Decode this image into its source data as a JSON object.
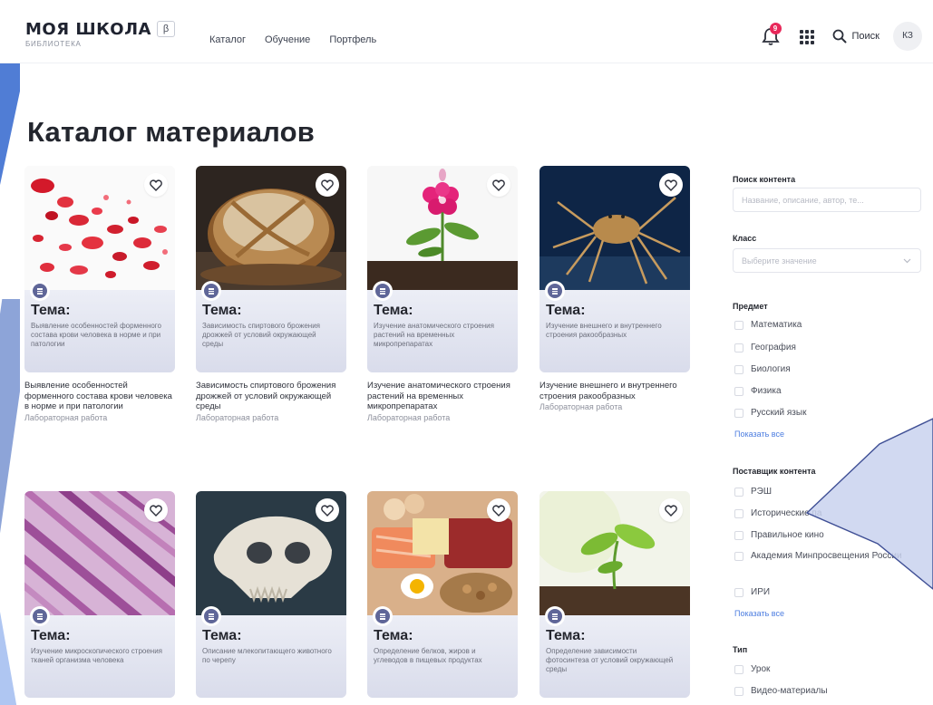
{
  "header": {
    "logo_title": "МОЯ ШКОЛА",
    "logo_beta": "β",
    "logo_subtitle": "БИБЛИОТЕКА",
    "nav": [
      "Каталог",
      "Обучение",
      "Портфель"
    ],
    "notifications_count": "9",
    "search_label": "Поиск",
    "avatar_initials": "КЗ"
  },
  "page_title": "Каталог материалов",
  "cards": [
    {
      "topic_head": "Тема:",
      "topic_text": "Выявление особенностей форменного состава крови человека в норме и при патологии",
      "title": "Выявление особенностей форменного состава крови человека в норме и при патологии",
      "type": "Лабораторная работа",
      "image": "blood-cells"
    },
    {
      "topic_head": "Тема:",
      "topic_text": "Зависимость спиртового брожения дрожжей от условий окружающей среды",
      "title": "Зависимость спиртового брожения дрожжей от условий окружающей среды",
      "type": "Лабораторная работа",
      "image": "bread"
    },
    {
      "topic_head": "Тема:",
      "topic_text": "Изучение анатомического строения растений на временных микропрепаратах",
      "title": "Изучение анатомического строения растений на временных микропрепаратах",
      "type": "Лабораторная работа",
      "image": "flower"
    },
    {
      "topic_head": "Тема:",
      "topic_text": "Изучение внешнего и внутреннего строения ракообразных",
      "title": "Изучение внешнего и внутреннего строения ракообразных",
      "type": "Лабораторная работа",
      "image": "crab"
    },
    {
      "topic_head": "Тема:",
      "topic_text": "Изучение микроскопического строения тканей организма человека",
      "title": "",
      "type": "",
      "image": "muscle-tissue"
    },
    {
      "topic_head": "Тема:",
      "topic_text": "Описание млекопитающего животного по черепу",
      "title": "",
      "type": "",
      "image": "skull"
    },
    {
      "topic_head": "Тема:",
      "topic_text": "Определение белков, жиров и углеводов в пищевых продуктах",
      "title": "",
      "type": "",
      "image": "food"
    },
    {
      "topic_head": "Тема:",
      "topic_text": "Определение зависимости фотосинтеза от условий окружающей среды",
      "title": "",
      "type": "",
      "image": "sprout"
    }
  ],
  "sidebar": {
    "search_head": "Поиск контента",
    "search_placeholder": "Название, описание, автор, те...",
    "class_head": "Класс",
    "class_placeholder": "Выберите значение",
    "subject_head": "Предмет",
    "subjects": [
      "Математика",
      "География",
      "Биология",
      "Физика",
      "Русский язык"
    ],
    "show_all_1": "Показать все",
    "provider_head": "Поставщик контента",
    "providers": [
      "РЭШ",
      "Исторические па",
      "Правильное кино",
      "Академия Минпросвещения России",
      "ИРИ"
    ],
    "show_all_2": "Показать все",
    "type_head": "Тип",
    "types": [
      "Урок",
      "Видео-материалы"
    ]
  },
  "colors": {
    "accent_link": "#4c7de0",
    "badge_red": "#e8285a",
    "doc_badge": "#5f6698",
    "callout_fill": "#c9d2ee",
    "callout_stroke": "#3f4f95"
  }
}
